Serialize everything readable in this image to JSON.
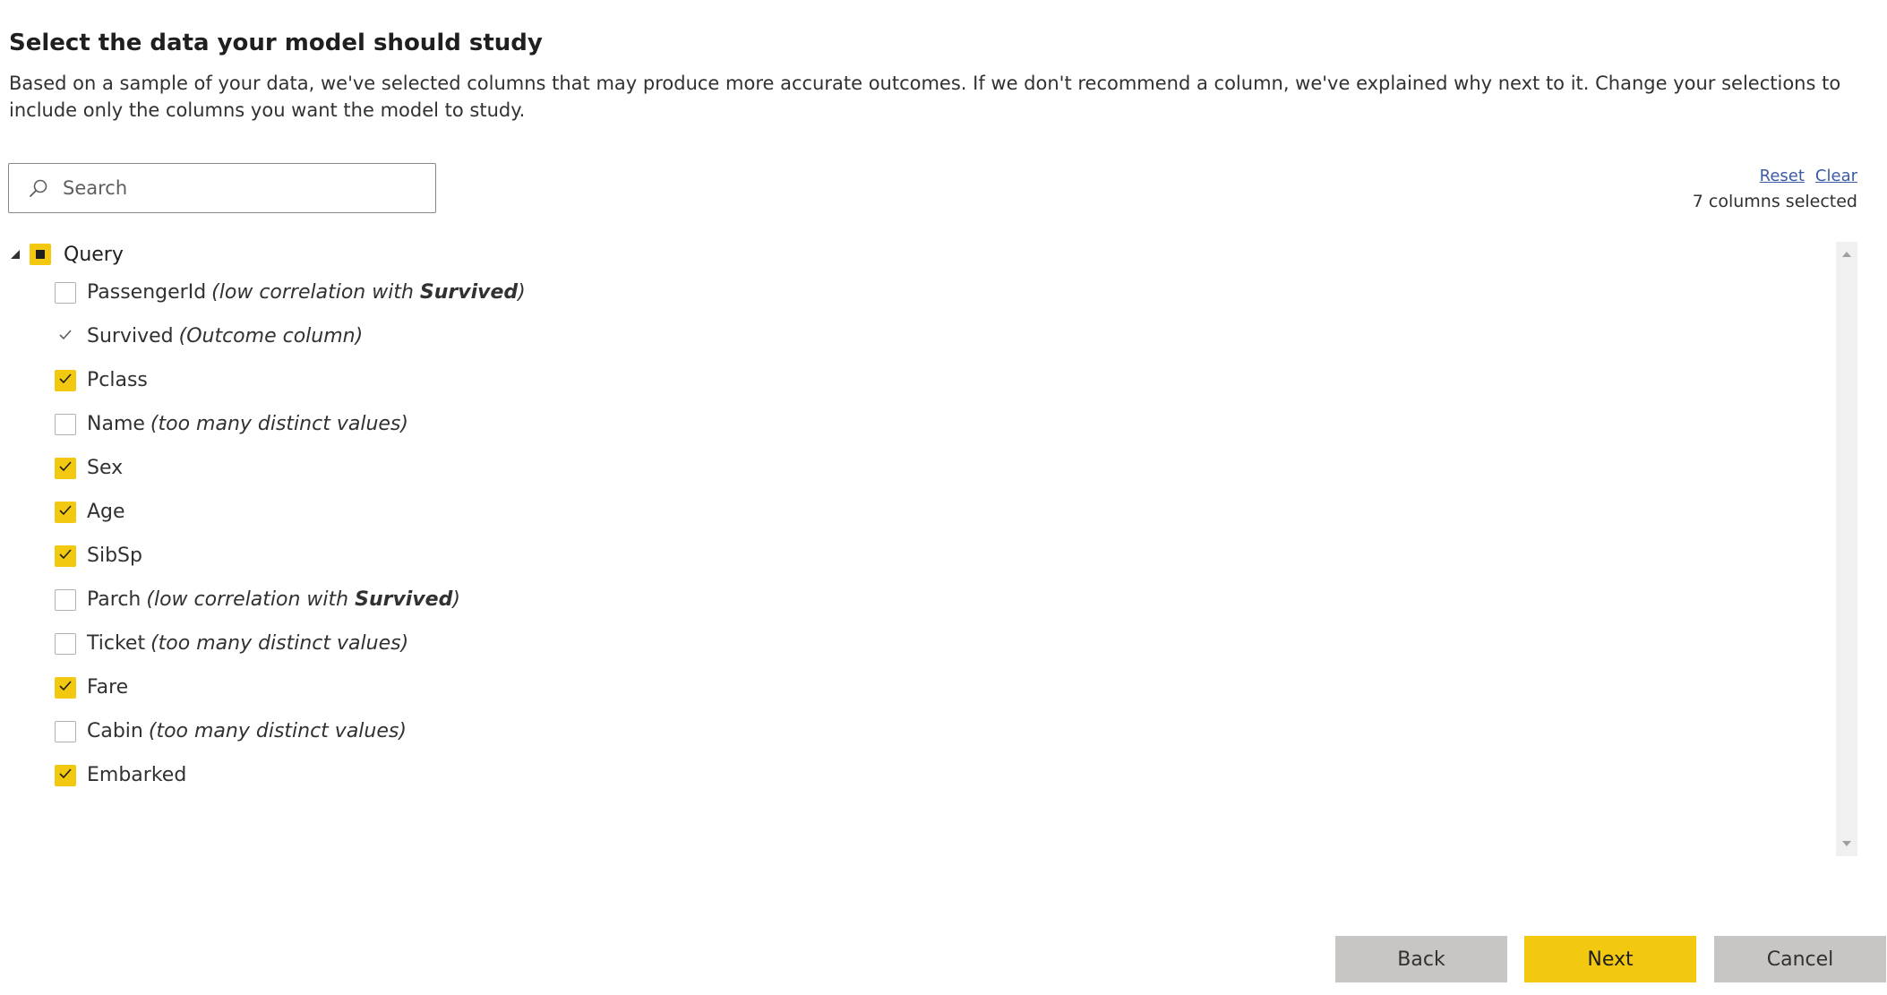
{
  "page": {
    "title": "Select the data your model should study",
    "description": "Based on a sample of your data, we've selected columns that may produce more accurate outcomes. If we don't recommend a column, we've explained why next to it. Change your selections to include only the columns you want the model to study."
  },
  "search": {
    "placeholder": "Search",
    "value": "",
    "icon": "search-icon"
  },
  "links": {
    "reset": "Reset",
    "clear": "Clear"
  },
  "selected_count": "7 columns selected",
  "tree": {
    "root": {
      "label": "Query",
      "state": "indeterminate",
      "expanded": true
    },
    "items": [
      {
        "name": "PassengerId",
        "note_prefix": "(low correlation with ",
        "note_bold": "Survived",
        "note_suffix": ")",
        "state": "unchecked"
      },
      {
        "name": "Survived",
        "note_prefix": "(Outcome column)",
        "note_bold": "",
        "note_suffix": "",
        "state": "disabled-checked"
      },
      {
        "name": "Pclass",
        "note_prefix": "",
        "note_bold": "",
        "note_suffix": "",
        "state": "checked"
      },
      {
        "name": "Name",
        "note_prefix": "(too many distinct values)",
        "note_bold": "",
        "note_suffix": "",
        "state": "unchecked"
      },
      {
        "name": "Sex",
        "note_prefix": "",
        "note_bold": "",
        "note_suffix": "",
        "state": "checked"
      },
      {
        "name": "Age",
        "note_prefix": "",
        "note_bold": "",
        "note_suffix": "",
        "state": "checked"
      },
      {
        "name": "SibSp",
        "note_prefix": "",
        "note_bold": "",
        "note_suffix": "",
        "state": "checked"
      },
      {
        "name": "Parch",
        "note_prefix": "(low correlation with ",
        "note_bold": "Survived",
        "note_suffix": ")",
        "state": "unchecked"
      },
      {
        "name": "Ticket",
        "note_prefix": "(too many distinct values)",
        "note_bold": "",
        "note_suffix": "",
        "state": "unchecked"
      },
      {
        "name": "Fare",
        "note_prefix": "",
        "note_bold": "",
        "note_suffix": "",
        "state": "checked"
      },
      {
        "name": "Cabin",
        "note_prefix": "(too many distinct values)",
        "note_bold": "",
        "note_suffix": "",
        "state": "unchecked"
      },
      {
        "name": "Embarked",
        "note_prefix": "",
        "note_bold": "",
        "note_suffix": "",
        "state": "checked"
      }
    ]
  },
  "buttons": {
    "back": "Back",
    "next": "Next",
    "cancel": "Cancel"
  },
  "colors": {
    "accent": "#f2c811",
    "secondary_button": "#c8c6c4",
    "link": "#3b5ba5"
  }
}
